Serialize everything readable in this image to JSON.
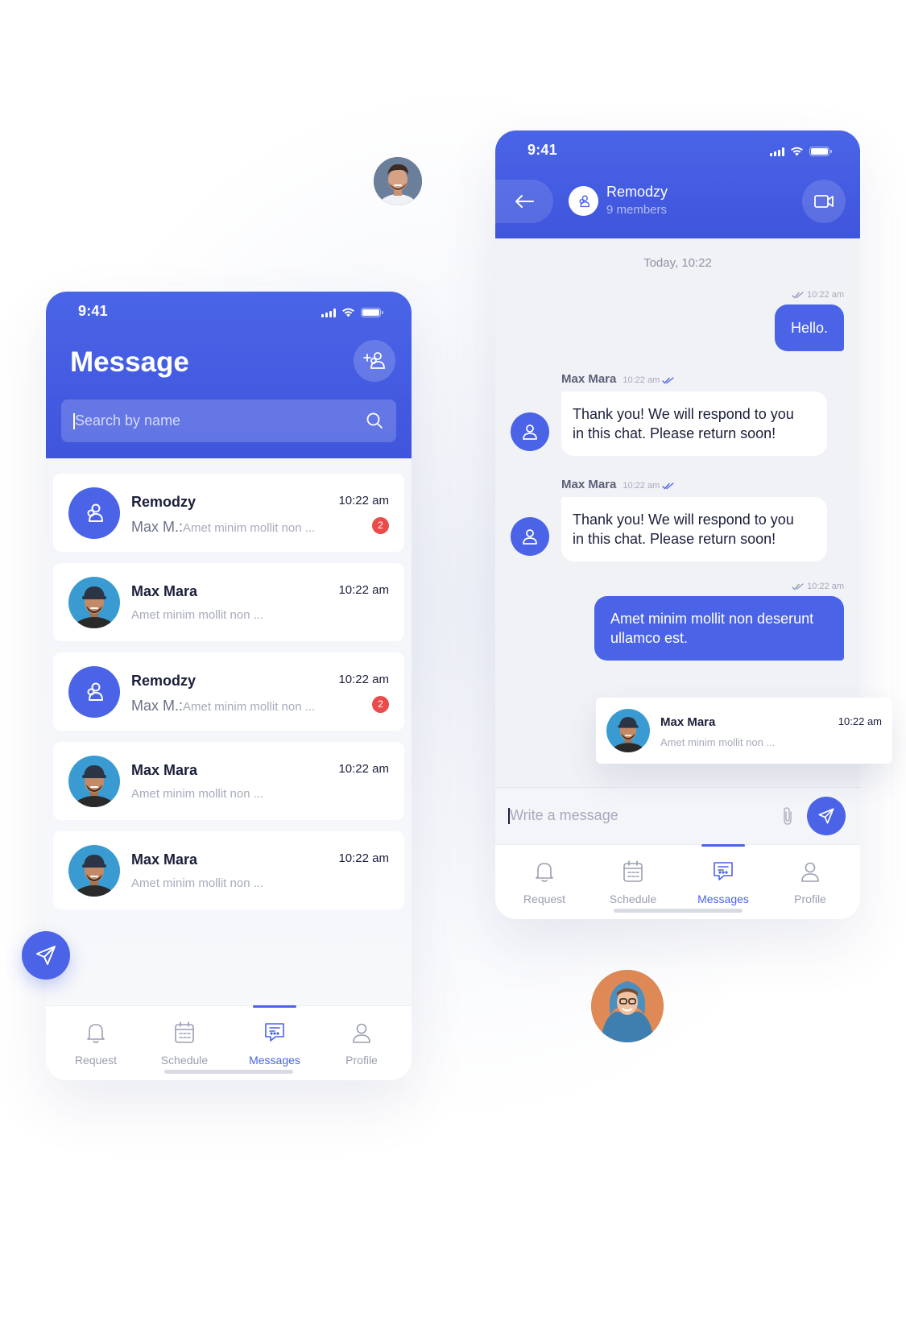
{
  "colors": {
    "primary": "#4a63e7",
    "badge": "#ea4b4b",
    "background": "#f4f5f9"
  },
  "status_bar": {
    "time": "9:41"
  },
  "left_screen": {
    "title": "Message",
    "add_group_icon": "add-group-icon",
    "search": {
      "placeholder": "Search by name",
      "icon": "search-icon"
    },
    "chats": [
      {
        "type": "group",
        "name": "Remodzy",
        "time": "10:22 am",
        "sender": "Max M.:",
        "preview": "Amet minim mollit non ...",
        "unread": "2"
      },
      {
        "type": "user",
        "name": "Max Mara",
        "time": "10:22 am",
        "sender": "",
        "preview": "Amet minim mollit non ...",
        "unread": ""
      },
      {
        "type": "group",
        "name": "Remodzy",
        "time": "10:22 am",
        "sender": "Max M.:",
        "preview": "Amet minim mollit non ...",
        "unread": "2"
      },
      {
        "type": "user",
        "name": "Max Mara",
        "time": "10:22 am",
        "sender": "",
        "preview": "Amet minim mollit non ...",
        "unread": ""
      },
      {
        "type": "user",
        "name": "Max Mara",
        "time": "10:22 am",
        "sender": "",
        "preview": "Amet minim mollit non ...",
        "unread": ""
      }
    ]
  },
  "tabbar": {
    "tabs": [
      {
        "label": "Request",
        "icon": "bell-icon",
        "active": false
      },
      {
        "label": "Schedule",
        "icon": "calendar-icon",
        "active": false
      },
      {
        "label": "Messages",
        "icon": "chat-icon",
        "active": true
      },
      {
        "label": "Profile",
        "icon": "profile-icon",
        "active": false
      }
    ]
  },
  "right_screen": {
    "group_name": "Remodzy",
    "members": "9 members",
    "day_separator": "Today, 10:22",
    "messages": [
      {
        "direction": "out",
        "time": "10:22 am",
        "text": "Hello."
      },
      {
        "direction": "in",
        "sender": "Max Mara",
        "time": "10:22 am",
        "text_line1": "Thank you! We will respond to you",
        "text_line2": "in this chat. Please return soon!"
      },
      {
        "direction": "in",
        "sender": "Max Mara",
        "time": "10:22 am",
        "text_line1": "Thank you! We will respond to you",
        "text_line2": "in this chat. Please return soon!"
      },
      {
        "direction": "out",
        "time": "10:22 am",
        "text_line1": "Amet minim mollit non deserunt",
        "text_line2": "ullamco est."
      }
    ],
    "compose": {
      "placeholder": "Write a message",
      "attach_icon": "paperclip-icon",
      "send_icon": "send-icon"
    }
  },
  "notification": {
    "name": "Max Mara",
    "time": "10:22 am",
    "preview": "Amet minim mollit non ..."
  }
}
